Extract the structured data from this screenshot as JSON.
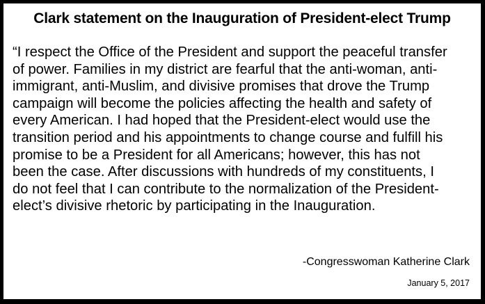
{
  "document": {
    "title": "Clark statement on the Inauguration of President-elect Trump",
    "body_lines": [
      "“I respect the Office of the President and support the peaceful transfer",
      "of power. Families in my district are fearful that the anti-woman, anti-",
      "immigrant, anti-Muslim, and divisive promises that drove the Trump",
      "campaign will become the policies affecting the health and safety of",
      "every American. I had hoped that the President-elect would use the",
      "transition period and his appointments to change course and fulfill his",
      "promise to be a President for all Americans; however, this has not",
      "been the case. After discussions with hundreds of my constituents, I",
      "do not feel that I can contribute to the normalization of the President-",
      "elect’s divisive rhetoric by participating in the Inauguration."
    ],
    "attribution": "-Congresswoman Katherine Clark",
    "date": "January 5, 2017"
  },
  "colors": {
    "border": "#000000",
    "background": "#ffffff",
    "text": "#000000"
  }
}
